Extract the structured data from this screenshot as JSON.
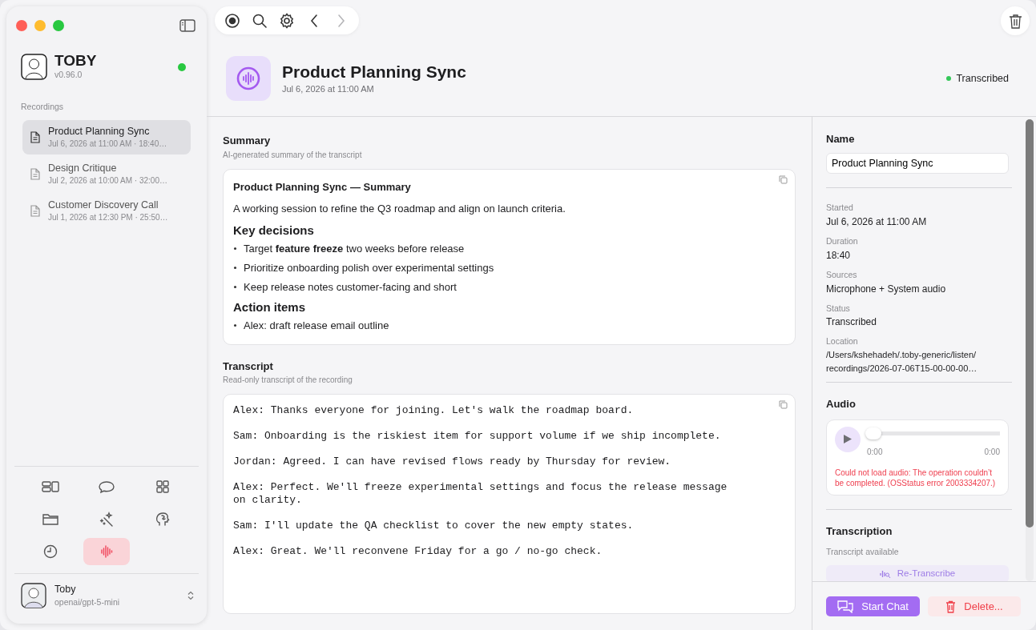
{
  "app": {
    "name": "TOBY",
    "version": "v0.96.0",
    "online": true
  },
  "sidebar": {
    "section_label": "Recordings",
    "items": [
      {
        "title": "Product Planning Sync",
        "subtitle": "Jul 6, 2026 at 11:00 AM · 18:40…",
        "selected": true
      },
      {
        "title": "Design Critique",
        "subtitle": "Jul 2, 2026 at 10:00 AM · 32:00…",
        "selected": false
      },
      {
        "title": "Customer Discovery Call",
        "subtitle": "Jul 1, 2026 at 12:30 PM · 25:50…",
        "selected": false
      }
    ]
  },
  "nav": [
    {
      "kind": "layout",
      "selected": false
    },
    {
      "kind": "chat",
      "selected": false
    },
    {
      "kind": "grid",
      "selected": false
    },
    {
      "kind": "folder",
      "selected": false
    },
    {
      "kind": "magic",
      "selected": false
    },
    {
      "kind": "brain",
      "selected": false
    },
    {
      "kind": "clock",
      "selected": false
    },
    {
      "kind": "waveform",
      "selected": true
    }
  ],
  "profile": {
    "name": "Toby",
    "model": "openai/gpt-5-mini"
  },
  "toolbar": [
    {
      "kind": "record",
      "disabled": false
    },
    {
      "kind": "search",
      "disabled": false
    },
    {
      "kind": "settings",
      "disabled": false
    },
    {
      "kind": "back",
      "disabled": false
    },
    {
      "kind": "forward",
      "disabled": true
    }
  ],
  "header": {
    "title": "Product Planning Sync",
    "date": "Jul 6, 2026 at 11:00 AM",
    "status": {
      "label": "Transcribed",
      "color": "#34c759"
    }
  },
  "summary": {
    "label": "Summary",
    "hint": "AI-generated summary of the transcript",
    "blocks": [
      {
        "kind": "title",
        "text": "Product Planning Sync — Summary"
      },
      {
        "kind": "paragraph",
        "text": "A working session to refine the Q3 roadmap and align on launch criteria."
      },
      {
        "kind": "heading",
        "text": "Key decisions"
      },
      {
        "kind": "bullet",
        "text": "Target **feature freeze** two weeks before release"
      },
      {
        "kind": "bullet",
        "text": "Prioritize onboarding polish over experimental settings"
      },
      {
        "kind": "bullet",
        "text": "Keep release notes customer-facing and short"
      },
      {
        "kind": "heading",
        "text": "Action items"
      },
      {
        "kind": "bullet",
        "text": "Alex: draft release email outline"
      }
    ]
  },
  "transcript": {
    "label": "Transcript",
    "hint": "Read-only transcript of the recording",
    "lines": [
      "Alex: Thanks everyone for joining. Let's walk the roadmap board.",
      "Sam: Onboarding is the riskiest item for support volume if we ship incomplete.",
      "Jordan: Agreed. I can have revised flows ready by Thursday for review.",
      "Alex: Perfect. We'll freeze experimental settings and focus the release message on clarity.",
      "Sam: I'll update the QA checklist to cover the new empty states.",
      "Alex: Great. We'll reconvene Friday for a go / no-go check."
    ]
  },
  "details": {
    "name_label": "Name",
    "name_value": "Product Planning Sync",
    "fields": [
      {
        "label": "Started",
        "value": "Jul 6, 2026 at 11:00 AM"
      },
      {
        "label": "Duration",
        "value": "18:40"
      },
      {
        "label": "Sources",
        "value": "Microphone + System audio"
      },
      {
        "label": "Status",
        "value": "Transcribed"
      },
      {
        "label": "Location",
        "value": "/Users/kshehadeh/.toby-generic/listen/ recordings/2026-07-06T15-00-00-00…"
      }
    ],
    "audio": {
      "label": "Audio",
      "level": 0,
      "time_current": "0:00",
      "time_total": "0:00",
      "error": "Could not load audio: The operation couldn’t be completed. (OSStatus error 2003334207.)"
    },
    "transcription": {
      "label": "Transcription",
      "status": "Transcript available",
      "button": "Re-Transcribe"
    }
  },
  "footer": {
    "primary": "Start Chat",
    "danger": "Delete..."
  }
}
